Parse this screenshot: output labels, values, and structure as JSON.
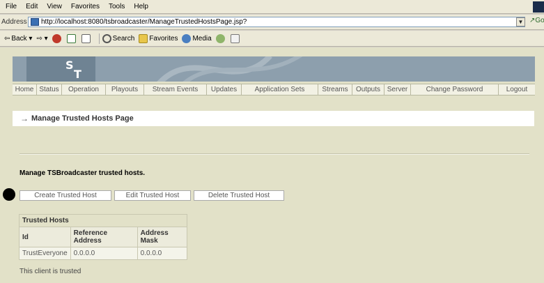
{
  "browser": {
    "menu": [
      "File",
      "Edit",
      "View",
      "Favorites",
      "Tools",
      "Help"
    ],
    "address_label": "Address",
    "url": "http://localhost:8080/tsbroadcaster/ManageTrustedHostsPage.jsp?",
    "go_label": "Go",
    "toolbar": {
      "back": "Back",
      "search": "Search",
      "favorites": "Favorites",
      "media": "Media"
    }
  },
  "app": {
    "logo_s": "S",
    "logo_t": "T",
    "nav": [
      "Home",
      "Status",
      "Operation",
      "Playouts",
      "Stream Events",
      "Updates",
      "Application Sets",
      "Streams",
      "Outputs",
      "Server",
      "Change Password",
      "Logout"
    ]
  },
  "main": {
    "title": "Manage Trusted Hosts Page",
    "subheading": "Manage TSBroadcaster trusted hosts.",
    "buttons": {
      "create": "Create Trusted Host",
      "edit": "Edit Trusted Host",
      "delete": "Delete Trusted Host"
    },
    "table": {
      "caption": "Trusted Hosts",
      "headers": [
        "Id",
        "Reference Address",
        "Address Mask"
      ],
      "rows": [
        [
          "TrustEveryone",
          "0.0.0.0",
          "0.0.0.0"
        ]
      ]
    },
    "status": "This client is trusted"
  }
}
